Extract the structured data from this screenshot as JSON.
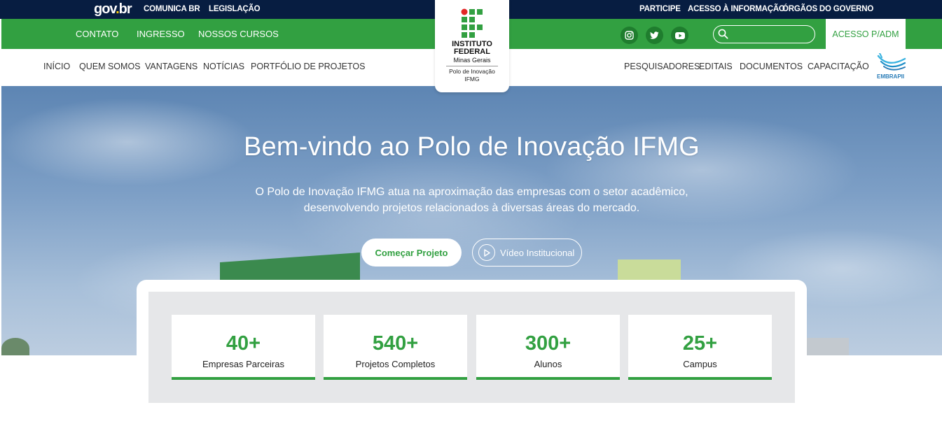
{
  "gov_bar": {
    "logo_prefix": "gov",
    "logo_dot": ".",
    "logo_suffix": "br",
    "left_links": [
      "COMUNICA BR",
      "LEGISLAÇÃO"
    ],
    "right_links": [
      "PARTICIPE",
      "ACESSO À INFORMAÇÃO",
      "ÓRGÃOS DO GOVERNO"
    ]
  },
  "green_bar": {
    "links": [
      "CONTATO",
      "INGRESSO",
      "NOSSOS CURSOS"
    ],
    "social_icons": [
      "instagram-icon",
      "twitter-icon",
      "youtube-icon"
    ],
    "search_placeholder": "",
    "access_label": "ACESSO P/ADM"
  },
  "logo": {
    "line1": "INSTITUTO",
    "line2": "FEDERAL",
    "line3": "Minas Gerais",
    "line4": "Polo de Inovação",
    "line5": "IFMG"
  },
  "nav": {
    "left_items": [
      "INÍCIO",
      "QUEM SOMOS",
      "VANTAGENS",
      "NOTÍCIAS",
      "PORTFÓLIO DE PROJETOS"
    ],
    "right_items": [
      "PESQUISADORES",
      "EDITAIS",
      "DOCUMENTOS",
      "CAPACITAÇÃO"
    ],
    "partner_logo_text": "EMBRAPII"
  },
  "hero": {
    "title": "Bem-vindo ao Polo de Inovação IFMG",
    "subtitle_line1": "O Polo de Inovação IFMG atua na aproximação das empresas com o setor acadêmico,",
    "subtitle_line2": "desenvolvendo projetos relacionados à diversas áreas do mercado.",
    "primary_button": "Começar Projeto",
    "secondary_button": "Vídeo Institucional"
  },
  "stats": [
    {
      "value": "40+",
      "label": "Empresas Parceiras"
    },
    {
      "value": "540+",
      "label": "Projetos Completos"
    },
    {
      "value": "300+",
      "label": "Alunos"
    },
    {
      "value": "25+",
      "label": "Campus"
    }
  ],
  "colors": {
    "gov_blue": "#071d41",
    "brand_green": "#32a041",
    "stats_panel": "#e6e7e9"
  }
}
